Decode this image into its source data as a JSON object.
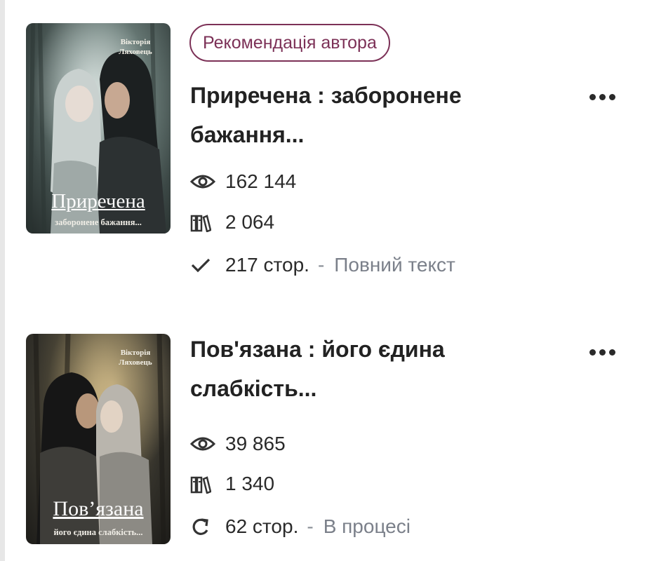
{
  "books": [
    {
      "badge": "Рекомендація автора",
      "title": "Приречена : заборонене бажання...",
      "cover": {
        "author": "Вікторія Ляховець",
        "title": "Приречена",
        "subtitle": "заборонене бажання..."
      },
      "views": "162 144",
      "library": "2 064",
      "pages": "217 стор.",
      "separator": "-",
      "status": "Повний текст",
      "status_icon": "check-icon"
    },
    {
      "title": "Пов'язана : його єдина слабкість...",
      "cover": {
        "author": "Вікторія Ляховець",
        "title": "Пов’язана",
        "subtitle": "його єдина слабкість..."
      },
      "views": "39 865",
      "library": "1 340",
      "pages": "62 стор.",
      "separator": "-",
      "status": "В процесі",
      "status_icon": "refresh-icon"
    }
  ],
  "colors": {
    "badge": "#7c3157",
    "status_text": "#7b808a",
    "text": "#222222"
  }
}
